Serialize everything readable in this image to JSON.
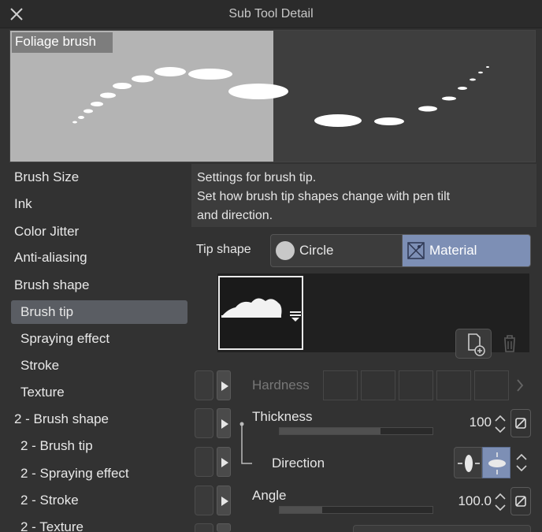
{
  "window": {
    "title": "Sub Tool Detail"
  },
  "preview": {
    "name": "Foliage brush"
  },
  "categories": [
    "Brush Size",
    "Ink",
    "Color Jitter",
    "Anti-aliasing",
    "Brush shape",
    "Brush tip",
    "Spraying effect",
    "Stroke",
    "Texture",
    "2 - Brush shape",
    "2 - Brush tip",
    "2 - Spraying effect",
    "2 - Stroke",
    "2 - Texture"
  ],
  "selected_category": "Brush tip",
  "description": {
    "line1": "Settings for brush tip.",
    "line2": "Set how brush tip shapes change with pen tilt",
    "line3": "and direction."
  },
  "tip_shape": {
    "label": "Tip shape",
    "options": [
      "Circle",
      "Material"
    ],
    "selected": "Material"
  },
  "params": {
    "hardness": {
      "label": "Hardness",
      "enabled": false
    },
    "thickness": {
      "label": "Thickness",
      "value": "100",
      "fill_fraction": 0.66
    },
    "direction": {
      "label": "Direction"
    },
    "angle": {
      "label": "Angle",
      "value": "100.0",
      "fill_fraction": 0.28
    }
  },
  "colors": {
    "accent": "#7d8fb5",
    "panel": "#323232",
    "selected_item": "#5a5d63"
  },
  "icons": [
    "close-icon",
    "circle-icon",
    "material-icon",
    "menu-icon",
    "add-material-icon",
    "trash-icon",
    "play-icon",
    "spin-arrows-icon",
    "reset-icon",
    "chevron-right-icon",
    "direction-icon"
  ]
}
